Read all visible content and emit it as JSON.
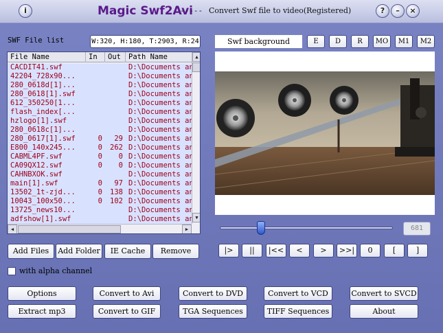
{
  "title_bar": {
    "info_icon_glyph": "i",
    "app_name": "Magic  Swf2Avi",
    "separator": "-----",
    "subtitle": "Convert Swf file to video(Registered)",
    "help_glyph": "?",
    "minimize_glyph": "–",
    "close_glyph": "×"
  },
  "file_list": {
    "title": "SWF File list",
    "dimension_info": "W:320, H:180, T:2903, R:24",
    "columns": [
      "File Name",
      "In",
      "Out",
      "Path Name"
    ],
    "rows": [
      {
        "name": "CACDIT41.swf",
        "in": "",
        "out": "",
        "path": "D:\\Documents an"
      },
      {
        "name": "42204_728x90...",
        "in": "",
        "out": "",
        "path": "D:\\Documents an"
      },
      {
        "name": "280_0618d[1]...",
        "in": "",
        "out": "",
        "path": "D:\\Documents an"
      },
      {
        "name": "280_0618[1].swf",
        "in": "",
        "out": "",
        "path": "D:\\Documents an"
      },
      {
        "name": "612_350250[1...",
        "in": "",
        "out": "",
        "path": "D:\\Documents an"
      },
      {
        "name": "flash_index[...",
        "in": "",
        "out": "",
        "path": "D:\\Documents an"
      },
      {
        "name": "hzlogo[1].swf",
        "in": "",
        "out": "",
        "path": "D:\\Documents an"
      },
      {
        "name": "280_0618c[1]...",
        "in": "",
        "out": "",
        "path": "D:\\Documents an"
      },
      {
        "name": "280_0617[1].swf",
        "in": "0",
        "out": "29",
        "path": "D:\\Documents an"
      },
      {
        "name": "E800_140x245...",
        "in": "0",
        "out": "262",
        "path": "D:\\Documents an"
      },
      {
        "name": "CABML4PF.swf",
        "in": "0",
        "out": "0",
        "path": "D:\\Documents an"
      },
      {
        "name": "CA09QX12.swf",
        "in": "0",
        "out": "0",
        "path": "D:\\Documents an"
      },
      {
        "name": "CAHNBXOK.swf",
        "in": "",
        "out": "",
        "path": "D:\\Documents an"
      },
      {
        "name": "main[1].swf",
        "in": "0",
        "out": "97",
        "path": "D:\\Documents an"
      },
      {
        "name": "13502_1t-zjd...",
        "in": "0",
        "out": "138",
        "path": "D:\\Documents an"
      },
      {
        "name": "10043_100x50...",
        "in": "0",
        "out": "102",
        "path": "D:\\Documents an"
      },
      {
        "name": "13725_news10...",
        "in": "",
        "out": "",
        "path": "D:\\Documents an"
      },
      {
        "name": "adfshow[1].swf",
        "in": "",
        "out": "",
        "path": "D:\\Documents an"
      }
    ],
    "scroll_up_glyph": "▲",
    "scroll_down_glyph": "▼",
    "scroll_left_glyph": "◀",
    "scroll_right_glyph": "▶"
  },
  "list_buttons": {
    "add_files": "Add Files",
    "add_folder": "Add Folder",
    "ie_cache": "IE Cache",
    "remove": "Remove"
  },
  "preview": {
    "background_label": "Swf background",
    "mode_buttons": [
      "E",
      "D",
      "R",
      "MO",
      "M1",
      "M2"
    ],
    "frame_value": "681",
    "slider_position": 0.24
  },
  "playback_buttons": [
    "|>",
    "||",
    "|<<",
    "<",
    ">",
    ">>|",
    "0",
    "[",
    "]"
  ],
  "alpha": {
    "label": "with alpha channel",
    "checked": false
  },
  "actions": {
    "row1": [
      "Options",
      "Convert to Avi",
      "Convert to DVD",
      "Convert to VCD",
      "Convert to SVCD"
    ],
    "row2": [
      "Extract mp3",
      "Convert to GIF",
      "TGA Sequences",
      "TIFF Sequences",
      "About"
    ]
  },
  "colors": {
    "background": "#6a74b4",
    "list_row_text": "#a0001a",
    "list_bg": "#d8e2ff",
    "title_accent": "#5a1a8a"
  },
  "icons": {
    "info": "info-icon",
    "help": "help-icon",
    "minimize": "minimize-icon",
    "close": "close-icon"
  }
}
